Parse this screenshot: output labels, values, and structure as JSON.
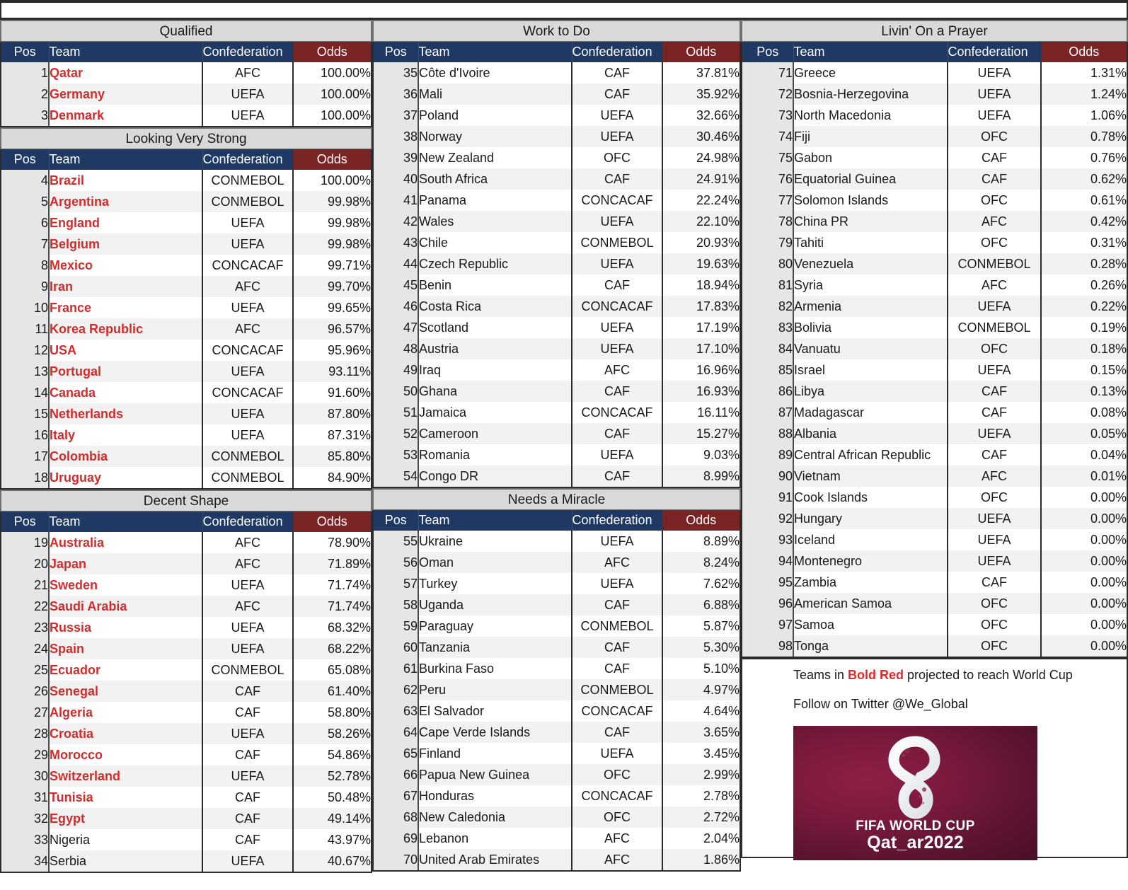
{
  "columns_headers": {
    "pos": "Pos",
    "team": "Team",
    "confederation": "Confederation",
    "odds": "Odds"
  },
  "colors": {
    "header_navy": "#1f3864",
    "header_maroon": "#7b2426",
    "qualified_red": "#d42b2b",
    "band_gray": "#d9d9d9"
  },
  "sections": [
    {
      "title": "Qualified",
      "rows": [
        {
          "pos": "1",
          "team": "Qatar",
          "confederation": "AFC",
          "odds": "100.00%",
          "projected": true
        },
        {
          "pos": "2",
          "team": "Germany",
          "confederation": "UEFA",
          "odds": "100.00%",
          "projected": true
        },
        {
          "pos": "3",
          "team": "Denmark",
          "confederation": "UEFA",
          "odds": "100.00%",
          "projected": true
        }
      ]
    },
    {
      "title": "Looking Very Strong",
      "rows": [
        {
          "pos": "4",
          "team": "Brazil",
          "confederation": "CONMEBOL",
          "odds": "100.00%",
          "projected": true
        },
        {
          "pos": "5",
          "team": "Argentina",
          "confederation": "CONMEBOL",
          "odds": "99.98%",
          "projected": true
        },
        {
          "pos": "6",
          "team": "England",
          "confederation": "UEFA",
          "odds": "99.98%",
          "projected": true
        },
        {
          "pos": "7",
          "team": "Belgium",
          "confederation": "UEFA",
          "odds": "99.98%",
          "projected": true
        },
        {
          "pos": "8",
          "team": "Mexico",
          "confederation": "CONCACAF",
          "odds": "99.71%",
          "projected": true
        },
        {
          "pos": "9",
          "team": "Iran",
          "confederation": "AFC",
          "odds": "99.70%",
          "projected": true
        },
        {
          "pos": "10",
          "team": "France",
          "confederation": "UEFA",
          "odds": "99.65%",
          "projected": true
        },
        {
          "pos": "11",
          "team": "Korea Republic",
          "confederation": "AFC",
          "odds": "96.57%",
          "projected": true
        },
        {
          "pos": "12",
          "team": "USA",
          "confederation": "CONCACAF",
          "odds": "95.96%",
          "projected": true
        },
        {
          "pos": "13",
          "team": "Portugal",
          "confederation": "UEFA",
          "odds": "93.11%",
          "projected": true
        },
        {
          "pos": "14",
          "team": "Canada",
          "confederation": "CONCACAF",
          "odds": "91.60%",
          "projected": true
        },
        {
          "pos": "15",
          "team": "Netherlands",
          "confederation": "UEFA",
          "odds": "87.80%",
          "projected": true
        },
        {
          "pos": "16",
          "team": "Italy",
          "confederation": "UEFA",
          "odds": "87.31%",
          "projected": true
        },
        {
          "pos": "17",
          "team": "Colombia",
          "confederation": "CONMEBOL",
          "odds": "85.80%",
          "projected": true
        },
        {
          "pos": "18",
          "team": "Uruguay",
          "confederation": "CONMEBOL",
          "odds": "84.90%",
          "projected": true
        }
      ]
    },
    {
      "title": "Decent Shape",
      "rows": [
        {
          "pos": "19",
          "team": "Australia",
          "confederation": "AFC",
          "odds": "78.90%",
          "projected": true
        },
        {
          "pos": "20",
          "team": "Japan",
          "confederation": "AFC",
          "odds": "71.89%",
          "projected": true
        },
        {
          "pos": "21",
          "team": "Sweden",
          "confederation": "UEFA",
          "odds": "71.74%",
          "projected": true
        },
        {
          "pos": "22",
          "team": "Saudi Arabia",
          "confederation": "AFC",
          "odds": "71.74%",
          "projected": true
        },
        {
          "pos": "23",
          "team": "Russia",
          "confederation": "UEFA",
          "odds": "68.32%",
          "projected": true
        },
        {
          "pos": "24",
          "team": "Spain",
          "confederation": "UEFA",
          "odds": "68.22%",
          "projected": true
        },
        {
          "pos": "25",
          "team": "Ecuador",
          "confederation": "CONMEBOL",
          "odds": "65.08%",
          "projected": true
        },
        {
          "pos": "26",
          "team": "Senegal",
          "confederation": "CAF",
          "odds": "61.40%",
          "projected": true
        },
        {
          "pos": "27",
          "team": "Algeria",
          "confederation": "CAF",
          "odds": "58.80%",
          "projected": true
        },
        {
          "pos": "28",
          "team": "Croatia",
          "confederation": "UEFA",
          "odds": "58.26%",
          "projected": true
        },
        {
          "pos": "29",
          "team": "Morocco",
          "confederation": "CAF",
          "odds": "54.86%",
          "projected": true
        },
        {
          "pos": "30",
          "team": "Switzerland",
          "confederation": "UEFA",
          "odds": "52.78%",
          "projected": true
        },
        {
          "pos": "31",
          "team": "Tunisia",
          "confederation": "CAF",
          "odds": "50.48%",
          "projected": true
        },
        {
          "pos": "32",
          "team": "Egypt",
          "confederation": "CAF",
          "odds": "49.14%",
          "projected": true
        },
        {
          "pos": "33",
          "team": "Nigeria",
          "confederation": "CAF",
          "odds": "43.97%",
          "projected": false
        },
        {
          "pos": "34",
          "team": "Serbia",
          "confederation": "UEFA",
          "odds": "40.67%",
          "projected": false
        }
      ]
    },
    {
      "title": "Work to Do",
      "rows": [
        {
          "pos": "35",
          "team": "Côte d'Ivoire",
          "confederation": "CAF",
          "odds": "37.81%",
          "projected": false
        },
        {
          "pos": "36",
          "team": "Mali",
          "confederation": "CAF",
          "odds": "35.92%",
          "projected": false
        },
        {
          "pos": "37",
          "team": "Poland",
          "confederation": "UEFA",
          "odds": "32.66%",
          "projected": false
        },
        {
          "pos": "38",
          "team": "Norway",
          "confederation": "UEFA",
          "odds": "30.46%",
          "projected": false
        },
        {
          "pos": "39",
          "team": "New Zealand",
          "confederation": "OFC",
          "odds": "24.98%",
          "projected": false
        },
        {
          "pos": "40",
          "team": "South Africa",
          "confederation": "CAF",
          "odds": "24.91%",
          "projected": false
        },
        {
          "pos": "41",
          "team": "Panama",
          "confederation": "CONCACAF",
          "odds": "22.24%",
          "projected": false
        },
        {
          "pos": "42",
          "team": "Wales",
          "confederation": "UEFA",
          "odds": "22.10%",
          "projected": false
        },
        {
          "pos": "43",
          "team": "Chile",
          "confederation": "CONMEBOL",
          "odds": "20.93%",
          "projected": false
        },
        {
          "pos": "44",
          "team": "Czech Republic",
          "confederation": "UEFA",
          "odds": "19.63%",
          "projected": false
        },
        {
          "pos": "45",
          "team": "Benin",
          "confederation": "CAF",
          "odds": "18.94%",
          "projected": false
        },
        {
          "pos": "46",
          "team": "Costa Rica",
          "confederation": "CONCACAF",
          "odds": "17.83%",
          "projected": false
        },
        {
          "pos": "47",
          "team": "Scotland",
          "confederation": "UEFA",
          "odds": "17.19%",
          "projected": false
        },
        {
          "pos": "48",
          "team": "Austria",
          "confederation": "UEFA",
          "odds": "17.10%",
          "projected": false
        },
        {
          "pos": "49",
          "team": "Iraq",
          "confederation": "AFC",
          "odds": "16.96%",
          "projected": false
        },
        {
          "pos": "50",
          "team": "Ghana",
          "confederation": "CAF",
          "odds": "16.93%",
          "projected": false
        },
        {
          "pos": "51",
          "team": "Jamaica",
          "confederation": "CONCACAF",
          "odds": "16.11%",
          "projected": false
        },
        {
          "pos": "52",
          "team": "Cameroon",
          "confederation": "CAF",
          "odds": "15.27%",
          "projected": false
        },
        {
          "pos": "53",
          "team": "Romania",
          "confederation": "UEFA",
          "odds": "9.03%",
          "projected": false
        },
        {
          "pos": "54",
          "team": "Congo DR",
          "confederation": "CAF",
          "odds": "8.99%",
          "projected": false
        }
      ]
    },
    {
      "title": "Needs a Miracle",
      "rows": [
        {
          "pos": "55",
          "team": "Ukraine",
          "confederation": "UEFA",
          "odds": "8.89%",
          "projected": false
        },
        {
          "pos": "56",
          "team": "Oman",
          "confederation": "AFC",
          "odds": "8.24%",
          "projected": false
        },
        {
          "pos": "57",
          "team": "Turkey",
          "confederation": "UEFA",
          "odds": "7.62%",
          "projected": false
        },
        {
          "pos": "58",
          "team": "Uganda",
          "confederation": "CAF",
          "odds": "6.88%",
          "projected": false
        },
        {
          "pos": "59",
          "team": "Paraguay",
          "confederation": "CONMEBOL",
          "odds": "5.87%",
          "projected": false
        },
        {
          "pos": "60",
          "team": "Tanzania",
          "confederation": "CAF",
          "odds": "5.30%",
          "projected": false
        },
        {
          "pos": "61",
          "team": "Burkina Faso",
          "confederation": "CAF",
          "odds": "5.10%",
          "projected": false
        },
        {
          "pos": "62",
          "team": "Peru",
          "confederation": "CONMEBOL",
          "odds": "4.97%",
          "projected": false
        },
        {
          "pos": "63",
          "team": "El Salvador",
          "confederation": "CONCACAF",
          "odds": "4.64%",
          "projected": false
        },
        {
          "pos": "64",
          "team": "Cape Verde Islands",
          "confederation": "CAF",
          "odds": "3.65%",
          "projected": false
        },
        {
          "pos": "65",
          "team": "Finland",
          "confederation": "UEFA",
          "odds": "3.45%",
          "projected": false
        },
        {
          "pos": "66",
          "team": "Papua New Guinea",
          "confederation": "OFC",
          "odds": "2.99%",
          "projected": false
        },
        {
          "pos": "67",
          "team": "Honduras",
          "confederation": "CONCACAF",
          "odds": "2.78%",
          "projected": false
        },
        {
          "pos": "68",
          "team": "New Caledonia",
          "confederation": "OFC",
          "odds": "2.72%",
          "projected": false
        },
        {
          "pos": "69",
          "team": "Lebanon",
          "confederation": "AFC",
          "odds": "2.04%",
          "projected": false
        },
        {
          "pos": "70",
          "team": "United Arab Emirates",
          "confederation": "AFC",
          "odds": "1.86%",
          "projected": false
        }
      ]
    },
    {
      "title": "Livin' On a Prayer",
      "rows": [
        {
          "pos": "71",
          "team": "Greece",
          "confederation": "UEFA",
          "odds": "1.31%",
          "projected": false
        },
        {
          "pos": "72",
          "team": "Bosnia-Herzegovina",
          "confederation": "UEFA",
          "odds": "1.24%",
          "projected": false
        },
        {
          "pos": "73",
          "team": "North Macedonia",
          "confederation": "UEFA",
          "odds": "1.06%",
          "projected": false
        },
        {
          "pos": "74",
          "team": "Fiji",
          "confederation": "OFC",
          "odds": "0.78%",
          "projected": false
        },
        {
          "pos": "75",
          "team": "Gabon",
          "confederation": "CAF",
          "odds": "0.76%",
          "projected": false
        },
        {
          "pos": "76",
          "team": "Equatorial Guinea",
          "confederation": "CAF",
          "odds": "0.62%",
          "projected": false
        },
        {
          "pos": "77",
          "team": "Solomon Islands",
          "confederation": "OFC",
          "odds": "0.61%",
          "projected": false
        },
        {
          "pos": "78",
          "team": "China PR",
          "confederation": "AFC",
          "odds": "0.42%",
          "projected": false
        },
        {
          "pos": "79",
          "team": "Tahiti",
          "confederation": "OFC",
          "odds": "0.31%",
          "projected": false
        },
        {
          "pos": "80",
          "team": "Venezuela",
          "confederation": "CONMEBOL",
          "odds": "0.28%",
          "projected": false
        },
        {
          "pos": "81",
          "team": "Syria",
          "confederation": "AFC",
          "odds": "0.26%",
          "projected": false
        },
        {
          "pos": "82",
          "team": "Armenia",
          "confederation": "UEFA",
          "odds": "0.22%",
          "projected": false
        },
        {
          "pos": "83",
          "team": "Bolivia",
          "confederation": "CONMEBOL",
          "odds": "0.19%",
          "projected": false
        },
        {
          "pos": "84",
          "team": "Vanuatu",
          "confederation": "OFC",
          "odds": "0.18%",
          "projected": false
        },
        {
          "pos": "85",
          "team": "Israel",
          "confederation": "UEFA",
          "odds": "0.15%",
          "projected": false
        },
        {
          "pos": "86",
          "team": "Libya",
          "confederation": "CAF",
          "odds": "0.13%",
          "projected": false
        },
        {
          "pos": "87",
          "team": "Madagascar",
          "confederation": "CAF",
          "odds": "0.08%",
          "projected": false
        },
        {
          "pos": "88",
          "team": "Albania",
          "confederation": "UEFA",
          "odds": "0.05%",
          "projected": false
        },
        {
          "pos": "89",
          "team": "Central African Republic",
          "confederation": "CAF",
          "odds": "0.04%",
          "projected": false
        },
        {
          "pos": "90",
          "team": "Vietnam",
          "confederation": "AFC",
          "odds": "0.01%",
          "projected": false
        },
        {
          "pos": "91",
          "team": "Cook Islands",
          "confederation": "OFC",
          "odds": "0.00%",
          "projected": false
        },
        {
          "pos": "92",
          "team": "Hungary",
          "confederation": "UEFA",
          "odds": "0.00%",
          "projected": false
        },
        {
          "pos": "93",
          "team": "Iceland",
          "confederation": "UEFA",
          "odds": "0.00%",
          "projected": false
        },
        {
          "pos": "94",
          "team": "Montenegro",
          "confederation": "UEFA",
          "odds": "0.00%",
          "projected": false
        },
        {
          "pos": "95",
          "team": "Zambia",
          "confederation": "CAF",
          "odds": "0.00%",
          "projected": false
        },
        {
          "pos": "96",
          "team": "American Samoa",
          "confederation": "OFC",
          "odds": "0.00%",
          "projected": false
        },
        {
          "pos": "97",
          "team": "Samoa",
          "confederation": "OFC",
          "odds": "0.00%",
          "projected": false
        },
        {
          "pos": "98",
          "team": "Tonga",
          "confederation": "OFC",
          "odds": "0.00%",
          "projected": false
        }
      ]
    }
  ],
  "layout": {
    "left_column_sections": [
      "Qualified",
      "Looking Very Strong",
      "Decent Shape"
    ],
    "mid_column_sections": [
      "Work to Do",
      "Needs a Miracle"
    ],
    "right_column_sections": [
      "Livin' On a Prayer"
    ]
  },
  "footer": {
    "legend_prefix": "Teams in ",
    "legend_highlight": "Bold Red",
    "legend_suffix": " projected to reach World Cup",
    "twitter": "Follow on Twitter @We_Global"
  },
  "logo": {
    "line1": "FIFA WORLD CUP",
    "line2": "Qat_ar2022"
  }
}
